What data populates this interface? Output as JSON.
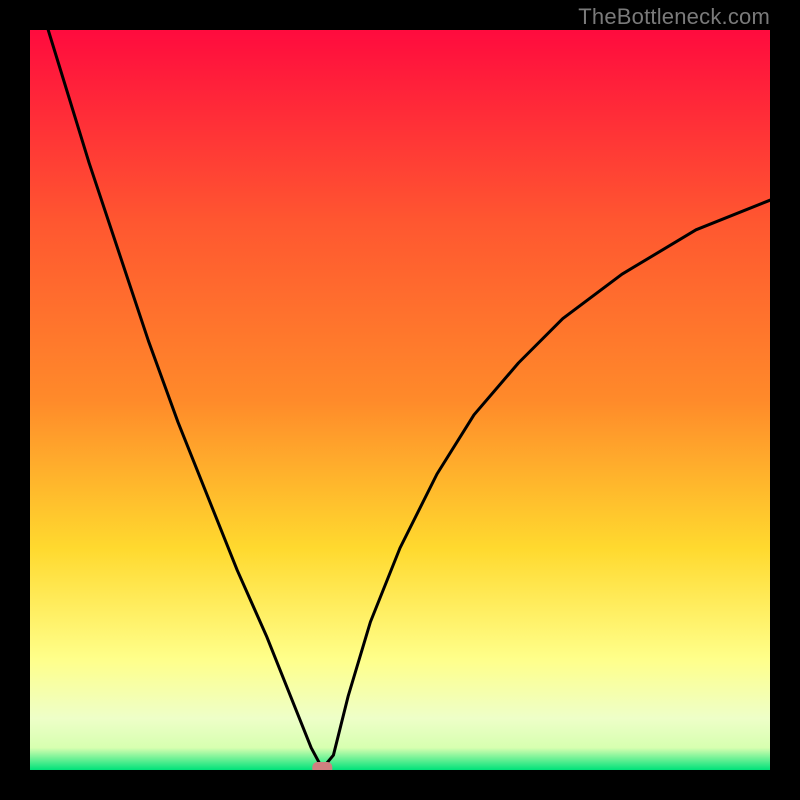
{
  "watermark": "TheBottleneck.com",
  "chart_data": {
    "type": "line",
    "title": "",
    "xlabel": "",
    "ylabel": "",
    "xlim": [
      0,
      100
    ],
    "ylim": [
      0,
      100
    ],
    "grid": false,
    "gradient_colors": {
      "top": "#ff0b3e",
      "mid_upper": "#ff8a2a",
      "mid": "#ffd92e",
      "mid_lower": "#ffff8a",
      "lower": "#d7ffb0",
      "bottom": "#00e27a"
    },
    "series": [
      {
        "name": "bottleneck-curve",
        "x": [
          0,
          4,
          8,
          12,
          16,
          20,
          24,
          28,
          32,
          36,
          38,
          39.5,
          41,
          42,
          43,
          46,
          50,
          55,
          60,
          66,
          72,
          80,
          90,
          100
        ],
        "y": [
          108,
          95,
          82,
          70,
          58,
          47,
          37,
          27,
          18,
          8,
          3,
          0.2,
          2,
          6,
          10,
          20,
          30,
          40,
          48,
          55,
          61,
          67,
          73,
          77
        ],
        "comment": "y expressed as percentage of plot height from bottom; values read off the image by visual estimation"
      }
    ],
    "marker": {
      "name": "optimal-point",
      "x": 39.5,
      "y": 0.0,
      "color": "#d08080",
      "shape": "rounded-rect"
    }
  }
}
